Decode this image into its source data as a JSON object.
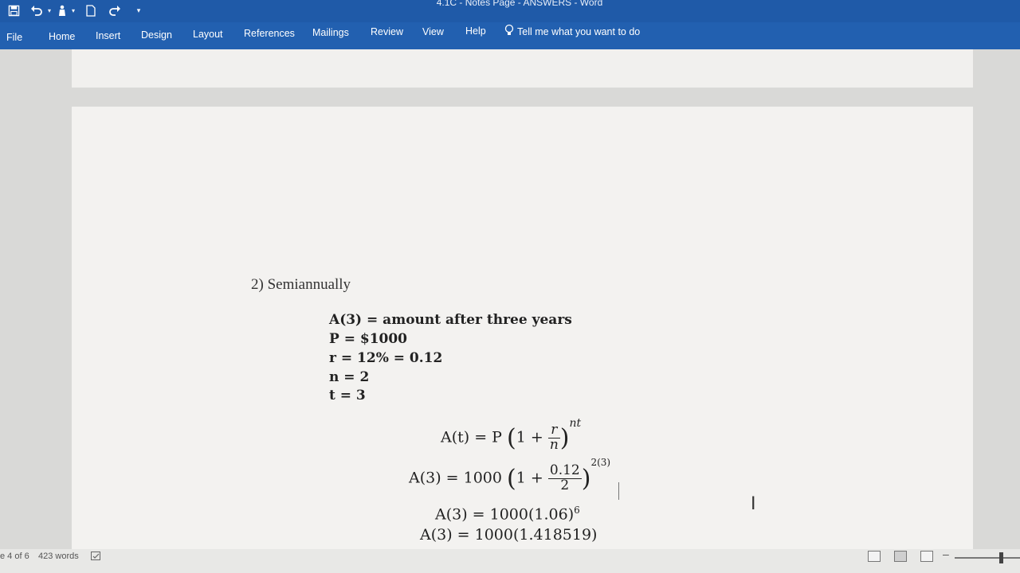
{
  "window": {
    "title": "4.1C - Notes Page - ANSWERS  -  Word"
  },
  "ribbon": {
    "tabs": [
      "File",
      "Home",
      "Insert",
      "Design",
      "Layout",
      "References",
      "Mailings",
      "Review",
      "View",
      "Help"
    ],
    "tell_me": "Tell me what you want to do"
  },
  "document": {
    "item_label": "2)  Semiannually",
    "given": {
      "a3": "A(3) = amount after three years",
      "p": "P = $1000",
      "r": "r = 12% = 0.12",
      "n": "n = 2",
      "t": "t = 3"
    },
    "formula": {
      "lhs": "A(t) = P",
      "one_plus": "1 +",
      "frac_num": "r",
      "frac_den": "n",
      "exponent": "nt"
    },
    "step1": {
      "lhs": "A(3) = 1000",
      "one_plus": "1 +",
      "frac_num": "0.12",
      "frac_den": "2",
      "exponent": "2(3)"
    },
    "step2": {
      "text": "A(3) = 1000(1.06)",
      "exponent": "6"
    },
    "step3": {
      "text": "A(3) = 1000(1.418519)"
    }
  },
  "status": {
    "page": "e 4 of 6",
    "words": "423 words"
  },
  "icons": [
    "save-icon",
    "undo-icon",
    "touch-mode-icon",
    "new-document-icon",
    "redo-icon",
    "customize-icon",
    "lightbulb-icon",
    "proofing-icon",
    "read-mode-icon",
    "print-layout-icon",
    "web-layout-icon",
    "i-beam-cursor-icon"
  ]
}
